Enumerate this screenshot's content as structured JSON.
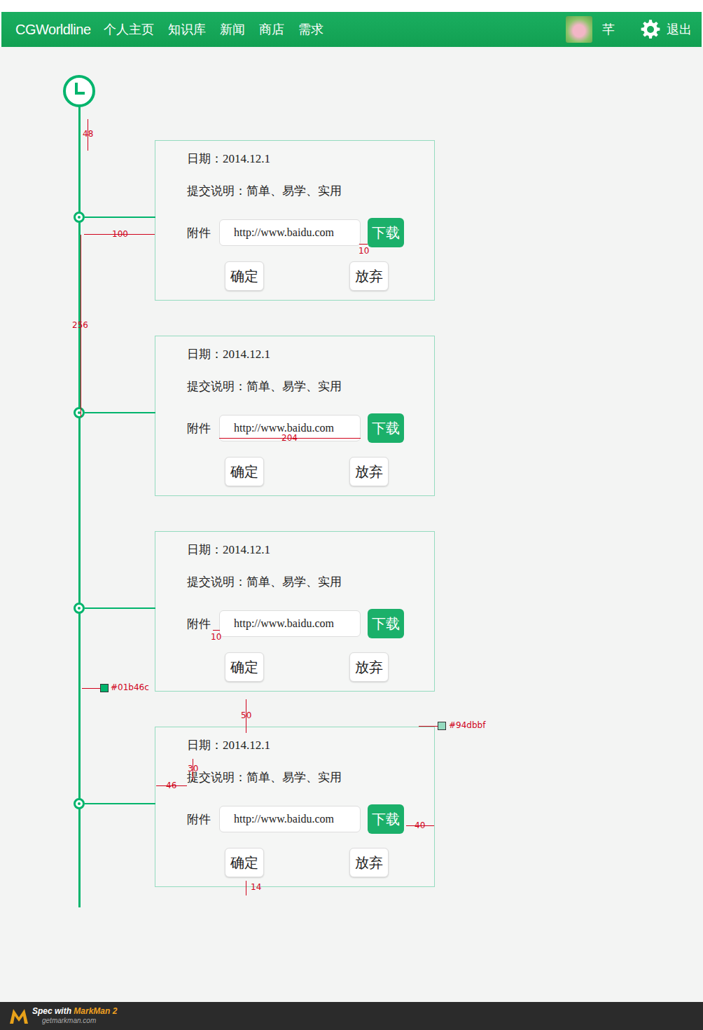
{
  "nav": {
    "logo": "CGWorldline",
    "menu": [
      {
        "label": "个人主页"
      },
      {
        "label": "知识库"
      },
      {
        "label": "新闻"
      },
      {
        "label": "商店"
      },
      {
        "label": "需求"
      }
    ],
    "user": {
      "name": "芊"
    },
    "logout": "退出"
  },
  "timeline": {
    "entries": [
      {
        "date_label": "日期：",
        "date": "2014.12.1",
        "desc_label": "提交说明：",
        "desc": "简单、易学、实用",
        "attach_label": "附件",
        "attach_value": "http://www.baidu.com",
        "download": "下载",
        "confirm": "确定",
        "cancel": "放弃"
      },
      {
        "date_label": "日期：",
        "date": "2014.12.1",
        "desc_label": "提交说明：",
        "desc": "简单、易学、实用",
        "attach_label": "附件",
        "attach_value": "http://www.baidu.com",
        "download": "下载",
        "confirm": "确定",
        "cancel": "放弃"
      },
      {
        "date_label": "日期：",
        "date": "2014.12.1",
        "desc_label": "提交说明：",
        "desc": "简单、易学、实用",
        "attach_label": "附件",
        "attach_value": "http://www.baidu.com",
        "download": "下载",
        "confirm": "确定",
        "cancel": "放弃"
      },
      {
        "date_label": "日期：",
        "date": "2014.12.1",
        "desc_label": "提交说明：",
        "desc": "简单、易学、实用",
        "attach_label": "附件",
        "attach_value": "http://www.baidu.com",
        "download": "下载",
        "confirm": "确定",
        "cancel": "放弃"
      }
    ]
  },
  "annotations": [
    {
      "text": "48"
    },
    {
      "text": "100"
    },
    {
      "text": "256"
    },
    {
      "text": "10"
    },
    {
      "text": "204"
    },
    {
      "text": "10"
    },
    {
      "text": "#01b46c",
      "color": "#01b46c"
    },
    {
      "text": "50"
    },
    {
      "text": "#94dbbf",
      "color": "#94dbbf"
    },
    {
      "text": "30"
    },
    {
      "text": "46"
    },
    {
      "text": "40"
    },
    {
      "text": "14"
    }
  ],
  "footer": {
    "prefix": "Spec with",
    "product": "MarkMan 2",
    "url": "getmarkman.com"
  }
}
